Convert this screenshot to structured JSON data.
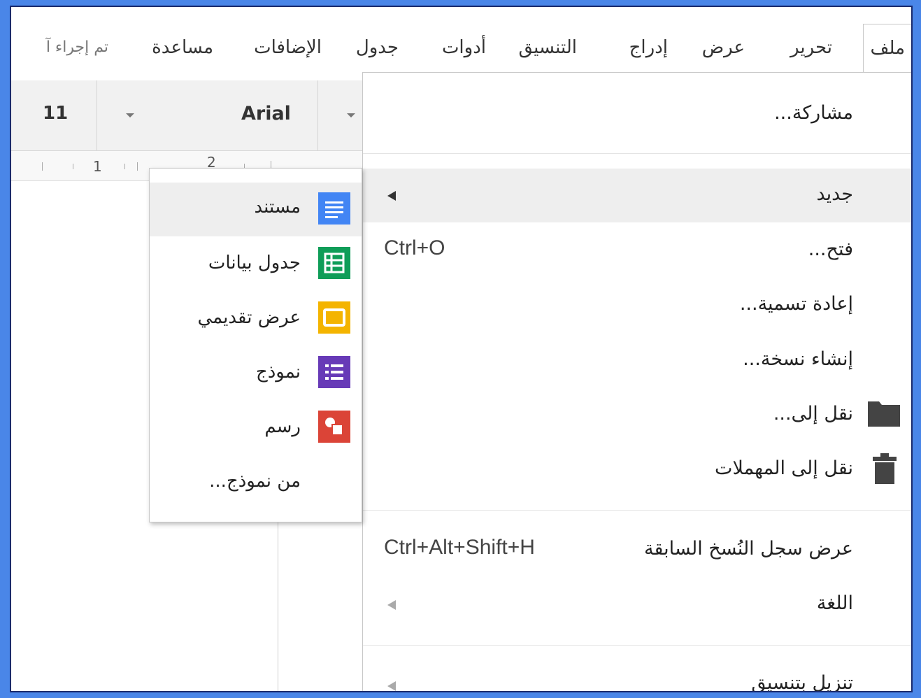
{
  "menubar": {
    "items": [
      {
        "label": "ملف"
      },
      {
        "label": "تحرير"
      },
      {
        "label": "عرض"
      },
      {
        "label": "إدراج"
      },
      {
        "label": "التنسيق"
      },
      {
        "label": "أدوات"
      },
      {
        "label": "جدول"
      },
      {
        "label": "الإضافات"
      },
      {
        "label": "مساعدة"
      },
      {
        "label": "تم إجراء آ"
      }
    ]
  },
  "toolbar": {
    "font_size": "11",
    "font_name": "Arial"
  },
  "ruler": {
    "marks": [
      "1",
      "2"
    ]
  },
  "file_menu": {
    "share": "مشاركة...",
    "new": "جديد",
    "open": "فتح...",
    "open_shortcut": "Ctrl+O",
    "rename": "إعادة تسمية...",
    "make_copy": "إنشاء نسخة...",
    "move_to": "نقل إلى...",
    "move_to_trash": "نقل إلى المهملات",
    "revision_history": "عرض سجل النُسخ السابقة",
    "revision_shortcut": "Ctrl+Alt+Shift+H",
    "language": "اللغة",
    "partial_item": "تنزيل بتنسيق"
  },
  "new_submenu": {
    "items": [
      {
        "label": "مستند",
        "icon": "docs-icon",
        "color": "#4285f4"
      },
      {
        "label": "جدول بيانات",
        "icon": "sheets-icon",
        "color": "#0f9d58"
      },
      {
        "label": "عرض تقديمي",
        "icon": "slides-icon",
        "color": "#f4b400"
      },
      {
        "label": "نموذج",
        "icon": "forms-icon",
        "color": "#673ab7"
      },
      {
        "label": "رسم",
        "icon": "drawings-icon",
        "color": "#db4437"
      },
      {
        "label": "من نموذج..."
      }
    ]
  },
  "colors": {
    "frame": "#4a86e8",
    "highlight": "#eeeeee"
  }
}
